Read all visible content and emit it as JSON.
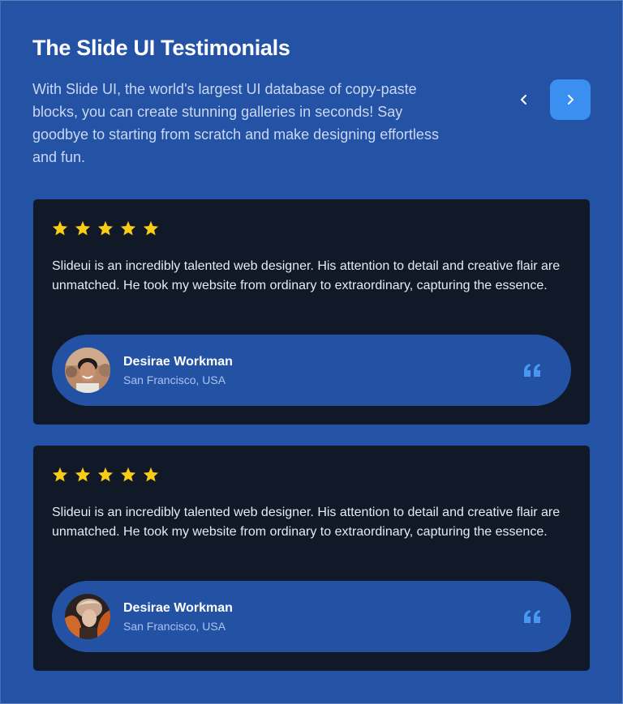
{
  "header": {
    "title": "The Slide UI Testimonials",
    "subtitle": "With Slide UI, the world's largest UI database of copy-paste blocks, you can create stunning galleries in seconds! Say goodbye to starting from scratch and make designing effortless and fun."
  },
  "nav": {
    "prev_icon": "chevron-left-icon",
    "next_icon": "chevron-right-icon"
  },
  "colors": {
    "background": "#2452a5",
    "card": "#111827",
    "author_pill": "#2352a4",
    "accent": "#3b8ff1",
    "star": "#facc15"
  },
  "testimonials": [
    {
      "rating": 5,
      "text": "Slideui is an incredibly talented web designer. His attention to detail and creative flair are unmatched. He took my website from ordinary to extraordinary, capturing the essence.",
      "name": "Desirae Workman",
      "location": "San Francisco, USA",
      "avatar": "avatar-photo"
    },
    {
      "rating": 5,
      "text": "Slideui is an incredibly talented web designer. His attention to detail and creative flair are unmatched. He took my website from ordinary to extraordinary, capturing the essence.",
      "name": "Desirae Workman",
      "location": "San Francisco, USA",
      "avatar": "avatar-photo"
    }
  ]
}
